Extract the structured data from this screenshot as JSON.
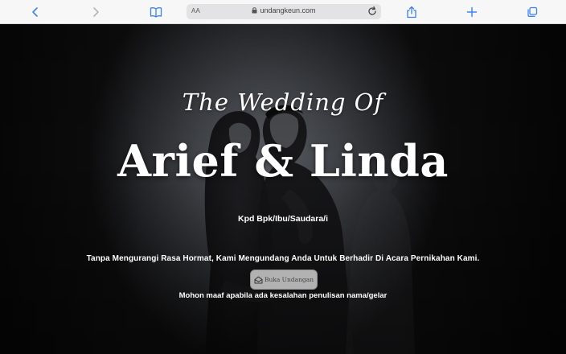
{
  "browser": {
    "reader_label": "AA",
    "url": "undangkeun.com"
  },
  "hero": {
    "script_title": "The Wedding Of",
    "couple_names": "Arief & Linda",
    "recipient_label": "Kpd Bpk/Ibu/Saudara/i",
    "invitation_message": "Tanpa Mengurangi Rasa Hormat, Kami Mengundang Anda Untuk Berhadir Di Acara Pernikahan Kami.",
    "open_button_label": "Buka Undangan",
    "apology_note": "Mohon maaf apabila ada kesalahan penulisan nama/gelar"
  },
  "colors": {
    "toolbar_icon": "#3b82f6",
    "toolbar_icon_disabled": "#b5b5b8",
    "toolbar_bg": "#f7f7f8",
    "url_field_bg": "#e3e3e6",
    "hero_text": "#ffffff"
  },
  "icons": {
    "back": "chevron-left-icon",
    "forward": "chevron-right-icon",
    "bookmarks": "book-icon",
    "lock": "lock-icon",
    "reload": "reload-icon",
    "share": "share-icon",
    "new_tab": "plus-icon",
    "tabs": "tabs-icon",
    "open_invitation": "envelope-open-icon"
  }
}
